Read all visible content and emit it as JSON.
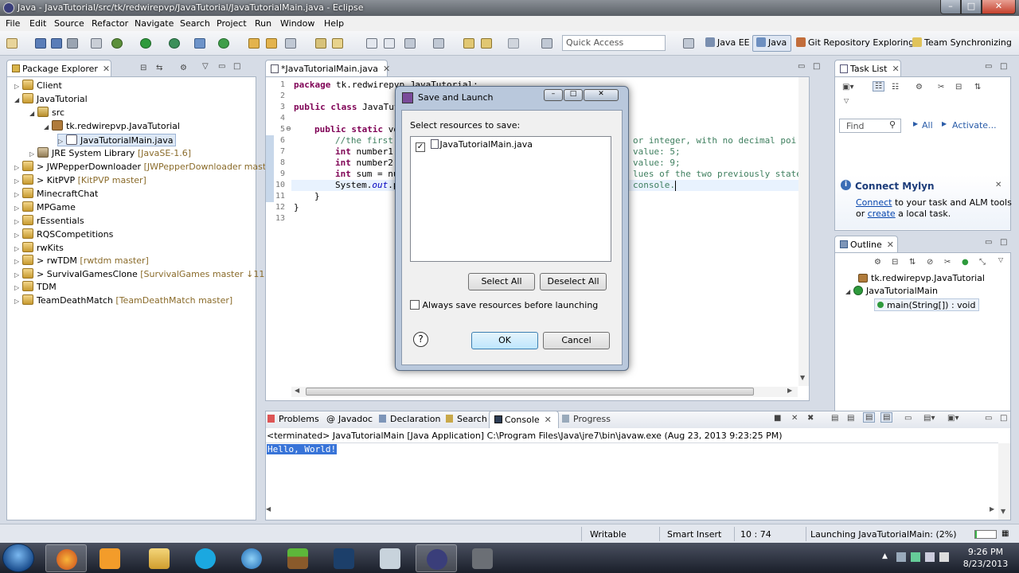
{
  "window": {
    "title": "Java - JavaTutorial/src/tk/redwirepvp/JavaTutorial/JavaTutorialMain.java - Eclipse"
  },
  "menu": [
    "File",
    "Edit",
    "Source",
    "Refactor",
    "Navigate",
    "Search",
    "Project",
    "Run",
    "Window",
    "Help"
  ],
  "toolbar": {
    "quick_access_placeholder": "Quick Access",
    "perspectives": [
      "Java EE",
      "Java",
      "Git Repository Exploring",
      "Team Synchronizing"
    ]
  },
  "package_explorer": {
    "tab_label": "Package Explorer",
    "items": [
      {
        "label": "Client",
        "decoration": ""
      },
      {
        "label": "JavaTutorial",
        "decoration": ""
      },
      {
        "label": "src",
        "decoration": ""
      },
      {
        "label": "tk.redwirepvp.JavaTutorial",
        "decoration": ""
      },
      {
        "label": "JavaTutorialMain.java",
        "decoration": ""
      },
      {
        "label": "JRE System Library",
        "decoration": "[JavaSE-1.6]"
      },
      {
        "label": "> JWPepperDownloader",
        "decoration": "[JWPepperDownloader mast"
      },
      {
        "label": "> KitPVP",
        "decoration": "[KitPVP master]"
      },
      {
        "label": "MinecraftChat",
        "decoration": ""
      },
      {
        "label": "MPGame",
        "decoration": ""
      },
      {
        "label": "rEssentials",
        "decoration": ""
      },
      {
        "label": "RQSCompetitions",
        "decoration": ""
      },
      {
        "label": "rwKits",
        "decoration": ""
      },
      {
        "label": "> rwTDM",
        "decoration": "[rwtdm master]"
      },
      {
        "label": "> SurvivalGamesClone",
        "decoration": "[SurvivalGames master ↓11]"
      },
      {
        "label": "TDM",
        "decoration": ""
      },
      {
        "label": "TeamDeathMatch",
        "decoration": "[TeamDeathMatch master]"
      }
    ]
  },
  "editor": {
    "tab_label": "*JavaTutorialMain.java",
    "line_numbers": [
      "1",
      "2",
      "3",
      "4",
      "5",
      "6",
      "7",
      "8",
      "9",
      "10",
      "11",
      "12",
      "13"
    ],
    "code": {
      "l1_kw": "package",
      "l1": " tk.redwirepvp.JavaTutorial;",
      "l3_kw1": "public class",
      "l3": " JavaTutorialMain {",
      "l5_kw": "public static",
      "l5": " vo",
      "l6_comment": "//the first",
      "l6_tail": "or integer, with no decimal poi",
      "l7_kw": "int",
      "l7": " number1 =",
      "l7_tail": "value: 5;",
      "l8_kw": "int",
      "l8": " number2 =",
      "l8_tail": "value: 9;",
      "l9_kw": "int",
      "l9": " sum = num",
      "l9_tail": "lues of the two previously stated",
      "l10_a": "System.",
      "l10_out": "out",
      "l10_b": ".pr",
      "l10_tail": "console.",
      "l11": "}",
      "l12": "}"
    }
  },
  "task_list": {
    "tab_label": "Task List",
    "find_placeholder": "Find",
    "all_label": "All",
    "activate_label": "Activate..."
  },
  "mylyn": {
    "title": "Connect Mylyn",
    "connect_link": "Connect",
    "text1": " to your task and ALM tools",
    "text2_prefix": "or ",
    "create_link": "create",
    "text2_suffix": " a local task."
  },
  "outline": {
    "tab_label": "Outline",
    "items": [
      "tk.redwirepvp.JavaTutorial",
      "JavaTutorialMain",
      "main(String[]) : void"
    ]
  },
  "dialog": {
    "title": "Save and Launch",
    "prompt": "Select resources to save:",
    "resources": [
      {
        "label": "JavaTutorialMain.java",
        "checked": "✓"
      }
    ],
    "select_all": "Select All",
    "deselect_all": "Deselect All",
    "always_save": "Always save resources before launching",
    "ok": "OK",
    "cancel": "Cancel"
  },
  "bottom_tabs": [
    "Problems",
    "Javadoc",
    "Declaration",
    "Search",
    "Console",
    "Progress"
  ],
  "console": {
    "header": "<terminated> JavaTutorialMain [Java Application] C:\\Program Files\\Java\\jre7\\bin\\javaw.exe (Aug 23, 2013 9:23:25 PM)",
    "output": "Hello, World!"
  },
  "status": {
    "writable": "Writable",
    "insert_mode": "Smart Insert",
    "position": "10 : 74",
    "launching": "Launching JavaTutorialMain: (2%)",
    "progress_fraction": 0.02
  },
  "taskbar": {
    "time": "9:26 PM",
    "date": "8/23/2013"
  }
}
